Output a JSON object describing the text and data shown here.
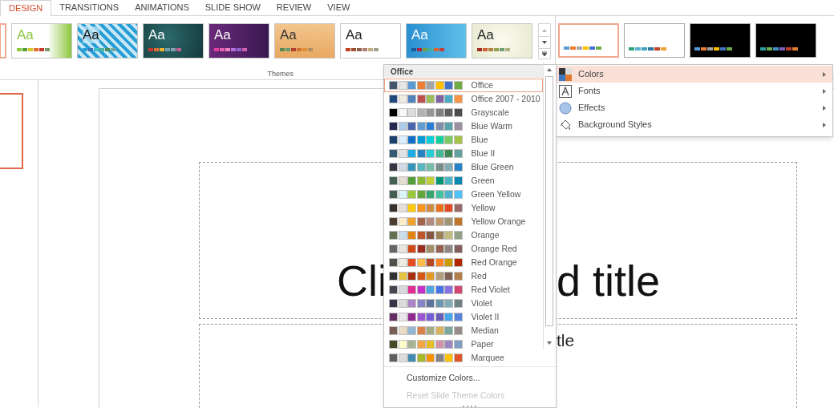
{
  "tabs": [
    {
      "label": "DESIGN",
      "selected": true
    },
    {
      "label": "TRANSITIONS",
      "selected": false
    },
    {
      "label": "ANIMATIONS",
      "selected": false
    },
    {
      "label": "SLIDE SHOW",
      "selected": false
    },
    {
      "label": "REVIEW",
      "selected": false
    },
    {
      "label": "VIEW",
      "selected": false
    }
  ],
  "themes": {
    "label": "Themes",
    "items": [
      {
        "selected": true
      },
      {
        "label": "Aa",
        "selected": false
      },
      {
        "label": "Aa",
        "selected": false
      },
      {
        "label": "Aa",
        "selected": false
      },
      {
        "label": "Aa",
        "selected": false
      },
      {
        "label": "Aa",
        "selected": false
      },
      {
        "label": "Aa",
        "selected": false
      },
      {
        "label": "Aa",
        "selected": false
      },
      {
        "label": "Aa",
        "selected": false
      }
    ]
  },
  "variants": [
    {
      "selected": true
    },
    {
      "selected": false
    },
    {
      "selected": false
    },
    {
      "selected": false
    }
  ],
  "variant_menu": [
    {
      "label": "Colors",
      "expanded": true
    },
    {
      "label": "Fonts",
      "expanded": false
    },
    {
      "label": "Effects",
      "expanded": false
    },
    {
      "label": "Background Styles",
      "expanded": false
    }
  ],
  "colors_menu": {
    "header": "Office",
    "schemes": [
      {
        "name": "Office",
        "selected": true,
        "swatches": [
          {
            "color": "#44546a"
          },
          {
            "color": "#e7e6e6"
          },
          {
            "color": "#5b9bd5"
          },
          {
            "color": "#ed7d31"
          },
          {
            "color": "#a5a5a5"
          },
          {
            "color": "#ffc000"
          },
          {
            "color": "#4472c4"
          },
          {
            "color": "#70ad47"
          }
        ]
      },
      {
        "name": "Office 2007 - 2010",
        "selected": false,
        "swatches": [
          {
            "color": "#1f497d"
          },
          {
            "color": "#eeece1"
          },
          {
            "color": "#4f81bd"
          },
          {
            "color": "#c0504d"
          },
          {
            "color": "#9bbb59"
          },
          {
            "color": "#8064a2"
          },
          {
            "color": "#4bacc6"
          },
          {
            "color": "#f79646"
          }
        ]
      },
      {
        "name": "Grayscale",
        "selected": false,
        "swatches": [
          {
            "color": "#000000"
          },
          {
            "color": "#f8f8f8"
          },
          {
            "color": "#dddddd"
          },
          {
            "color": "#b2b2b2"
          },
          {
            "color": "#969696"
          },
          {
            "color": "#808080"
          },
          {
            "color": "#5f5f5f"
          },
          {
            "color": "#4d4d4d"
          }
        ]
      },
      {
        "name": "Blue Warm",
        "selected": false,
        "swatches": [
          {
            "color": "#242852"
          },
          {
            "color": "#acccea"
          },
          {
            "color": "#4a66ac"
          },
          {
            "color": "#629dd1"
          },
          {
            "color": "#297fd5"
          },
          {
            "color": "#7f8fa9"
          },
          {
            "color": "#5aa2ae"
          },
          {
            "color": "#9d90a0"
          }
        ]
      },
      {
        "name": "Blue",
        "selected": false,
        "swatches": [
          {
            "color": "#17406d"
          },
          {
            "color": "#dbefff"
          },
          {
            "color": "#0f6fc6"
          },
          {
            "color": "#009dd9"
          },
          {
            "color": "#0bd0d9"
          },
          {
            "color": "#10cf9b"
          },
          {
            "color": "#7cca62"
          },
          {
            "color": "#a5c249"
          }
        ]
      },
      {
        "name": "Blue II",
        "selected": false,
        "swatches": [
          {
            "color": "#335b74"
          },
          {
            "color": "#dfe3e5"
          },
          {
            "color": "#1cade4"
          },
          {
            "color": "#2683c6"
          },
          {
            "color": "#27ced7"
          },
          {
            "color": "#42ba97"
          },
          {
            "color": "#3e8853"
          },
          {
            "color": "#62a39f"
          }
        ]
      },
      {
        "name": "Blue Green",
        "selected": false,
        "swatches": [
          {
            "color": "#373545"
          },
          {
            "color": "#cedbe6"
          },
          {
            "color": "#3494ba"
          },
          {
            "color": "#58b6c0"
          },
          {
            "color": "#75bda7"
          },
          {
            "color": "#7a8c8e"
          },
          {
            "color": "#84acb6"
          },
          {
            "color": "#2683c6"
          }
        ]
      },
      {
        "name": "Green",
        "selected": false,
        "swatches": [
          {
            "color": "#455f51"
          },
          {
            "color": "#e3ded1"
          },
          {
            "color": "#549e39"
          },
          {
            "color": "#8ab833"
          },
          {
            "color": "#c0cf3a"
          },
          {
            "color": "#029676"
          },
          {
            "color": "#4ab5c4"
          },
          {
            "color": "#0989b1"
          }
        ]
      },
      {
        "name": "Green Yellow",
        "selected": false,
        "swatches": [
          {
            "color": "#455f51"
          },
          {
            "color": "#dbf5f9"
          },
          {
            "color": "#99cb38"
          },
          {
            "color": "#63a537"
          },
          {
            "color": "#37a76f"
          },
          {
            "color": "#44c1a3"
          },
          {
            "color": "#4eb3cf"
          },
          {
            "color": "#51c3f9"
          }
        ]
      },
      {
        "name": "Yellow",
        "selected": false,
        "swatches": [
          {
            "color": "#39302a"
          },
          {
            "color": "#e5dedb"
          },
          {
            "color": "#ffca08"
          },
          {
            "color": "#f8931d"
          },
          {
            "color": "#ce8d3e"
          },
          {
            "color": "#ec7016"
          },
          {
            "color": "#e64823"
          },
          {
            "color": "#9c6a6a"
          }
        ]
      },
      {
        "name": "Yellow Orange",
        "selected": false,
        "swatches": [
          {
            "color": "#4e3b30"
          },
          {
            "color": "#fbeec9"
          },
          {
            "color": "#f0a22e"
          },
          {
            "color": "#a5644e"
          },
          {
            "color": "#b58b80"
          },
          {
            "color": "#c3986d"
          },
          {
            "color": "#a19574"
          },
          {
            "color": "#c17529"
          }
        ]
      },
      {
        "name": "Orange",
        "selected": false,
        "swatches": [
          {
            "color": "#637052"
          },
          {
            "color": "#ccddea"
          },
          {
            "color": "#e48312"
          },
          {
            "color": "#bd582c"
          },
          {
            "color": "#865640"
          },
          {
            "color": "#9b8357"
          },
          {
            "color": "#c2bc80"
          },
          {
            "color": "#94a088"
          }
        ]
      },
      {
        "name": "Orange Red",
        "selected": false,
        "swatches": [
          {
            "color": "#696464"
          },
          {
            "color": "#e9e5dc"
          },
          {
            "color": "#d34817"
          },
          {
            "color": "#9b2d1f"
          },
          {
            "color": "#a28e6a"
          },
          {
            "color": "#956251"
          },
          {
            "color": "#918485"
          },
          {
            "color": "#855d5d"
          }
        ]
      },
      {
        "name": "Red Orange",
        "selected": false,
        "swatches": [
          {
            "color": "#505046"
          },
          {
            "color": "#eeece1"
          },
          {
            "color": "#e84c22"
          },
          {
            "color": "#ffbd47"
          },
          {
            "color": "#b64926"
          },
          {
            "color": "#ff8427"
          },
          {
            "color": "#cc9900"
          },
          {
            "color": "#b22600"
          }
        ]
      },
      {
        "name": "Red",
        "selected": false,
        "swatches": [
          {
            "color": "#323232"
          },
          {
            "color": "#e5c243"
          },
          {
            "color": "#a5300f"
          },
          {
            "color": "#d55816"
          },
          {
            "color": "#e19825"
          },
          {
            "color": "#b19c7d"
          },
          {
            "color": "#7f5f52"
          },
          {
            "color": "#b27d49"
          }
        ]
      },
      {
        "name": "Red Violet",
        "selected": false,
        "swatches": [
          {
            "color": "#454551"
          },
          {
            "color": "#d8d9dc"
          },
          {
            "color": "#e32d91"
          },
          {
            "color": "#c830cc"
          },
          {
            "color": "#4ea6dc"
          },
          {
            "color": "#4775e7"
          },
          {
            "color": "#8971e1"
          },
          {
            "color": "#d54773"
          }
        ]
      },
      {
        "name": "Violet",
        "selected": false,
        "swatches": [
          {
            "color": "#373545"
          },
          {
            "color": "#dcd8dc"
          },
          {
            "color": "#ad84c6"
          },
          {
            "color": "#8784c7"
          },
          {
            "color": "#5d739a"
          },
          {
            "color": "#6997af"
          },
          {
            "color": "#84acb6"
          },
          {
            "color": "#6f8183"
          }
        ]
      },
      {
        "name": "Violet II",
        "selected": false,
        "swatches": [
          {
            "color": "#632e62"
          },
          {
            "color": "#eae5eb"
          },
          {
            "color": "#92278f"
          },
          {
            "color": "#9b57d3"
          },
          {
            "color": "#755dd9"
          },
          {
            "color": "#665eb8"
          },
          {
            "color": "#45a5ed"
          },
          {
            "color": "#5982db"
          }
        ]
      },
      {
        "name": "Median",
        "selected": false,
        "swatches": [
          {
            "color": "#775f55"
          },
          {
            "color": "#ebddc3"
          },
          {
            "color": "#94b6d2"
          },
          {
            "color": "#dd8047"
          },
          {
            "color": "#a5ab81"
          },
          {
            "color": "#d8b25c"
          },
          {
            "color": "#7ba79d"
          },
          {
            "color": "#968c8c"
          }
        ]
      },
      {
        "name": "Paper",
        "selected": false,
        "swatches": [
          {
            "color": "#444d26"
          },
          {
            "color": "#fefac9"
          },
          {
            "color": "#a5b592"
          },
          {
            "color": "#f3a447"
          },
          {
            "color": "#e7bc29"
          },
          {
            "color": "#d092a7"
          },
          {
            "color": "#9c85c0"
          },
          {
            "color": "#809ec2"
          }
        ]
      },
      {
        "name": "Marquee",
        "selected": false,
        "swatches": [
          {
            "color": "#5e5e5e"
          },
          {
            "color": "#dddddd"
          },
          {
            "color": "#418ab3"
          },
          {
            "color": "#a6b727"
          },
          {
            "color": "#f69200"
          },
          {
            "color": "#838383"
          },
          {
            "color": "#fec306"
          },
          {
            "color": "#df5327"
          }
        ]
      }
    ],
    "commands": [
      {
        "label": "Customize Colors...",
        "disabled": false
      },
      {
        "label": "Reset Slide Theme Colors",
        "disabled": true
      }
    ]
  },
  "slide": {
    "title_left": "Cli",
    "title_right": "d title",
    "subtitle": "tle"
  }
}
